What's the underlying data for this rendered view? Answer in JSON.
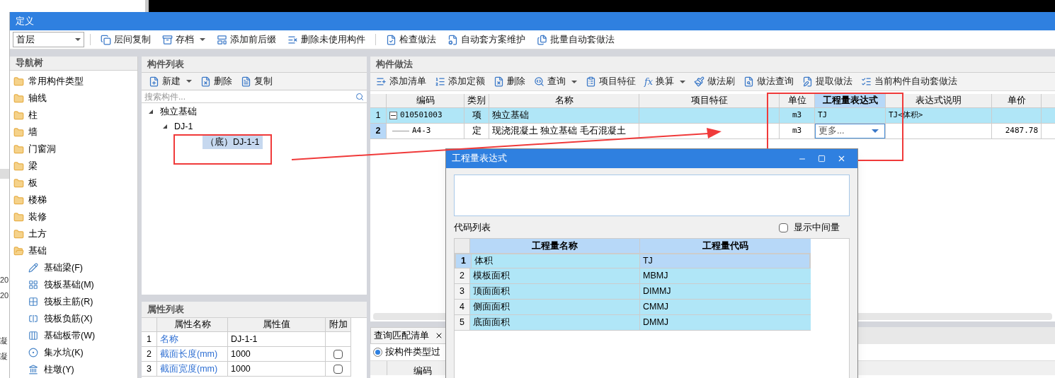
{
  "background_window": {
    "fragments": [
      "20",
      "20",
      "凝",
      "凝"
    ]
  },
  "window": {
    "title": "定义"
  },
  "toolbar": {
    "floor": "首层",
    "buttons": [
      {
        "label": "层间复制",
        "dropdown": false
      },
      {
        "label": "存档",
        "dropdown": true
      },
      {
        "label": "添加前后缀",
        "dropdown": false
      },
      {
        "label": "删除未使用构件",
        "dropdown": false
      },
      {
        "label": "检查做法",
        "dropdown": false
      },
      {
        "label": "自动套方案维护",
        "dropdown": false
      },
      {
        "label": "批量自动套做法",
        "dropdown": false
      }
    ]
  },
  "nav_tree": {
    "title": "导航树",
    "items": [
      {
        "label": "常用构件类型",
        "expanded": false
      },
      {
        "label": "轴线",
        "expanded": false
      },
      {
        "label": "柱",
        "expanded": false
      },
      {
        "label": "墙",
        "expanded": false
      },
      {
        "label": "门窗洞",
        "expanded": false
      },
      {
        "label": "梁",
        "expanded": false
      },
      {
        "label": "板",
        "expanded": false
      },
      {
        "label": "楼梯",
        "expanded": false
      },
      {
        "label": "装修",
        "expanded": false
      },
      {
        "label": "土方",
        "expanded": false
      },
      {
        "label": "基础",
        "expanded": true,
        "children": [
          {
            "label": "基础梁(F)"
          },
          {
            "label": "筏板基础(M)"
          },
          {
            "label": "筏板主筋(R)"
          },
          {
            "label": "筏板负筋(X)"
          },
          {
            "label": "基础板带(W)"
          },
          {
            "label": "集水坑(K)"
          },
          {
            "label": "柱墩(Y)"
          }
        ]
      }
    ]
  },
  "component_list": {
    "title": "构件列表",
    "toolbar": [
      {
        "label": "新建",
        "dropdown": true
      },
      {
        "label": "删除",
        "dropdown": false
      },
      {
        "label": "复制",
        "dropdown": false
      }
    ],
    "search": {
      "placeholder": "搜索构件..."
    },
    "tree": [
      {
        "label": "独立基础",
        "selected": false,
        "children": [
          {
            "label": "DJ-1",
            "selected": false,
            "children": [
              {
                "label": "（底）DJ-1-1",
                "selected": true
              }
            ]
          }
        ]
      }
    ]
  },
  "properties": {
    "title": "属性列表",
    "columns": [
      "属性名称",
      "属性值",
      "附加"
    ],
    "rows": [
      {
        "index": "1",
        "name": "名称",
        "value": "DJ-1-1"
      },
      {
        "index": "2",
        "name": "截面长度(mm)",
        "value": "1000",
        "checked": false
      },
      {
        "index": "3",
        "name": "截面宽度(mm)",
        "value": "1000",
        "checked": false
      }
    ]
  },
  "methods": {
    "title": "构件做法",
    "toolbar": [
      {
        "label": "添加清单",
        "dropdown": false
      },
      {
        "label": "添加定额",
        "dropdown": false
      },
      {
        "label": "删除",
        "dropdown": false
      },
      {
        "label": "查询",
        "dropdown": true
      },
      {
        "label": "项目特征",
        "dropdown": false
      },
      {
        "label": "换算",
        "dropdown": true,
        "icon_text": "fx"
      },
      {
        "label": "做法刷",
        "dropdown": false
      },
      {
        "label": "做法查询",
        "dropdown": false
      },
      {
        "label": "提取做法",
        "dropdown": false
      },
      {
        "label": "当前构件自动套做法",
        "dropdown": false
      }
    ],
    "columns": [
      "编码",
      "类别",
      "名称",
      "项目特征",
      "单位",
      "工程量表达式",
      "表达式说明",
      "单价"
    ],
    "rows": [
      {
        "index": "1",
        "code": "010501003",
        "kind": "项",
        "name": "独立基础",
        "unit": "m3",
        "expression": "TJ",
        "explanation": "TJ<体积>",
        "price": "",
        "highlighted": true,
        "current": false,
        "editing": false,
        "collapsible": true
      },
      {
        "index": "2",
        "code": "A4-3",
        "kind": "定",
        "name": "现浇混凝土 独立基础 毛石混凝土",
        "unit": "m3",
        "expression": "更多...",
        "explanation": "",
        "price": "2487.78",
        "highlighted": false,
        "current": true,
        "editing": true,
        "collapsible": false
      }
    ]
  },
  "query_panel": {
    "tab": "查询匹配清单",
    "filter": {
      "label": "按构件类型过",
      "selected": true
    },
    "column": "编码"
  },
  "dialog": {
    "title": "工程量表达式",
    "code_list_label": "代码列表",
    "show_intermediate": {
      "label": "显示中间量",
      "checked": false
    },
    "columns": [
      "工程量名称",
      "工程量代码"
    ],
    "rows": [
      {
        "index": "1",
        "name": "体积",
        "code": "TJ",
        "selected": true
      },
      {
        "index": "2",
        "name": "模板面积",
        "code": "MBMJ",
        "selected": false
      },
      {
        "index": "3",
        "name": "顶面面积",
        "code": "DIMMJ",
        "selected": false
      },
      {
        "index": "4",
        "name": "侧面面积",
        "code": "CMMJ",
        "selected": false
      },
      {
        "index": "5",
        "name": "底面面积",
        "code": "DMMJ",
        "selected": false
      }
    ]
  }
}
